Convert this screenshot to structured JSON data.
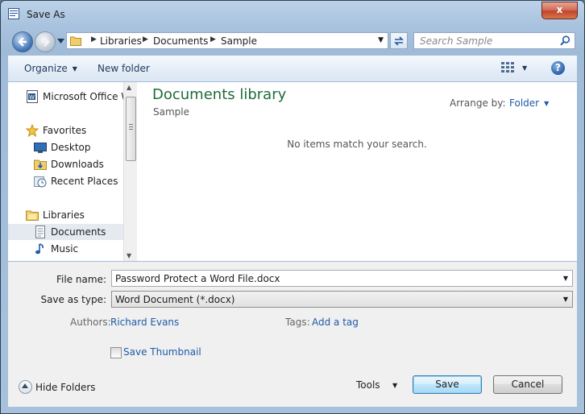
{
  "window": {
    "title": "Save As",
    "close_label": "x"
  },
  "address_bar": {
    "crumbs": [
      "Libraries",
      "Documents",
      "Sample"
    ]
  },
  "search": {
    "placeholder": "Search Sample"
  },
  "toolbar": {
    "organize_label": "Organize",
    "new_folder_label": "New folder",
    "help_label": "?"
  },
  "navigation": {
    "items": [
      {
        "label": "Microsoft Office W",
        "icon": "word-document-icon"
      },
      {
        "label": "Favorites",
        "icon": "star-icon"
      },
      {
        "label": "Desktop",
        "icon": "desktop-icon"
      },
      {
        "label": "Downloads",
        "icon": "downloads-folder-icon"
      },
      {
        "label": "Recent Places",
        "icon": "recent-places-icon"
      },
      {
        "label": "Libraries",
        "icon": "libraries-icon"
      },
      {
        "label": "Documents",
        "icon": "documents-icon",
        "selected": true
      },
      {
        "label": "Music",
        "icon": "music-icon"
      }
    ]
  },
  "content": {
    "library_title": "Documents library",
    "library_subtitle": "Sample",
    "arrange_by_label": "Arrange by:",
    "arrange_by_value": "Folder",
    "empty_message": "No items match your search."
  },
  "form": {
    "file_name_label": "File name:",
    "file_name_value": "Password Protect a Word File.docx",
    "save_as_type_label": "Save as type:",
    "save_as_type_value": "Word Document (*.docx)",
    "authors_label": "Authors:",
    "authors_value": "Richard Evans",
    "tags_label": "Tags:",
    "tags_value": "Add a tag",
    "save_thumbnail_label": "Save Thumbnail",
    "save_thumbnail_checked": false
  },
  "footer": {
    "hide_folders_label": "Hide Folders",
    "tools_label": "Tools",
    "save_label": "Save",
    "cancel_label": "Cancel"
  },
  "colors": {
    "library_title": "#1e6b39",
    "link": "#1e5aa8",
    "close_button": "#c2452b"
  }
}
